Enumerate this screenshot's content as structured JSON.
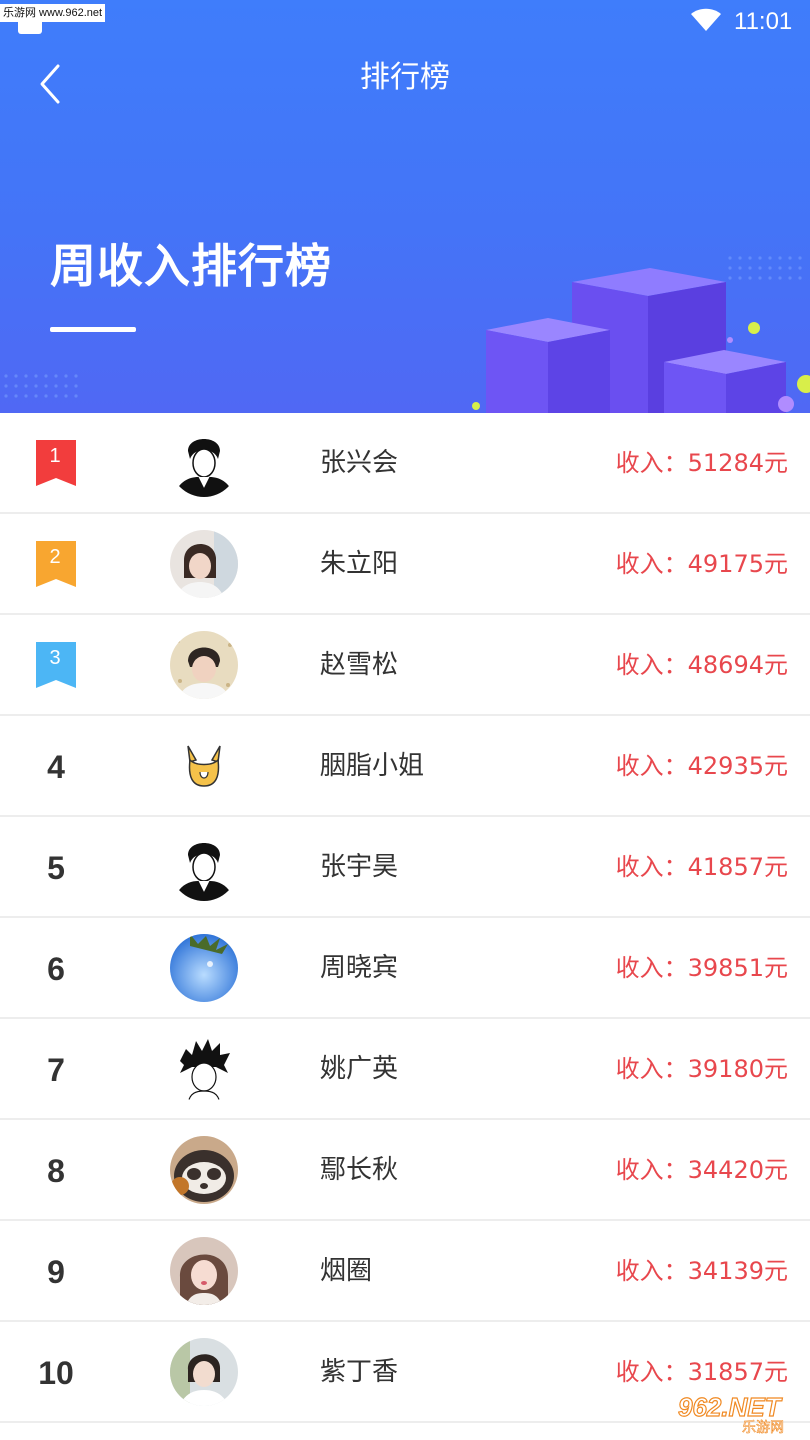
{
  "status_bar": {
    "watermark": "乐游网 www.962.net",
    "time": "11:01"
  },
  "nav": {
    "title": "排行榜"
  },
  "hero": {
    "title": "周收入排行榜"
  },
  "income_label": "收入：",
  "ranking": [
    {
      "rank": "1",
      "name": "张兴会",
      "income": "51284元",
      "ribbon_color": "#f23d3d",
      "avatar": "sketch-boy-avatar"
    },
    {
      "rank": "2",
      "name": "朱立阳",
      "income": "49175元",
      "ribbon_color": "#f8a630",
      "avatar": "girl-photo-avatar"
    },
    {
      "rank": "3",
      "name": "赵雪松",
      "income": "48694元",
      "ribbon_color": "#4cb6f5",
      "avatar": "boy-photo-avatar"
    },
    {
      "rank": "4",
      "name": "胭脂小姐",
      "income": "42935元",
      "avatar": "corgi-avatar"
    },
    {
      "rank": "5",
      "name": "张宇昊",
      "income": "41857元",
      "avatar": "sketch-boy-avatar"
    },
    {
      "rank": "6",
      "name": "周晓宾",
      "income": "39851元",
      "avatar": "sky-photo-avatar"
    },
    {
      "rank": "7",
      "name": "姚广英",
      "income": "39180元",
      "avatar": "sketch-hair-avatar"
    },
    {
      "rank": "8",
      "name": "鄢长秋",
      "income": "34420元",
      "avatar": "panda-avatar"
    },
    {
      "rank": "9",
      "name": "烟圈",
      "income": "34139元",
      "avatar": "girl-photo-avatar"
    },
    {
      "rank": "10",
      "name": "紫丁香",
      "income": "31857元",
      "avatar": "girl-photo-avatar"
    }
  ],
  "watermark_bottom": {
    "logo_text": "962.NET",
    "sub_text": "乐游网"
  },
  "colors": {
    "accent": "#4474f7",
    "income": "#e8474d",
    "rank1": "#f23d3d",
    "rank2": "#f8a630",
    "rank3": "#4cb6f5"
  }
}
